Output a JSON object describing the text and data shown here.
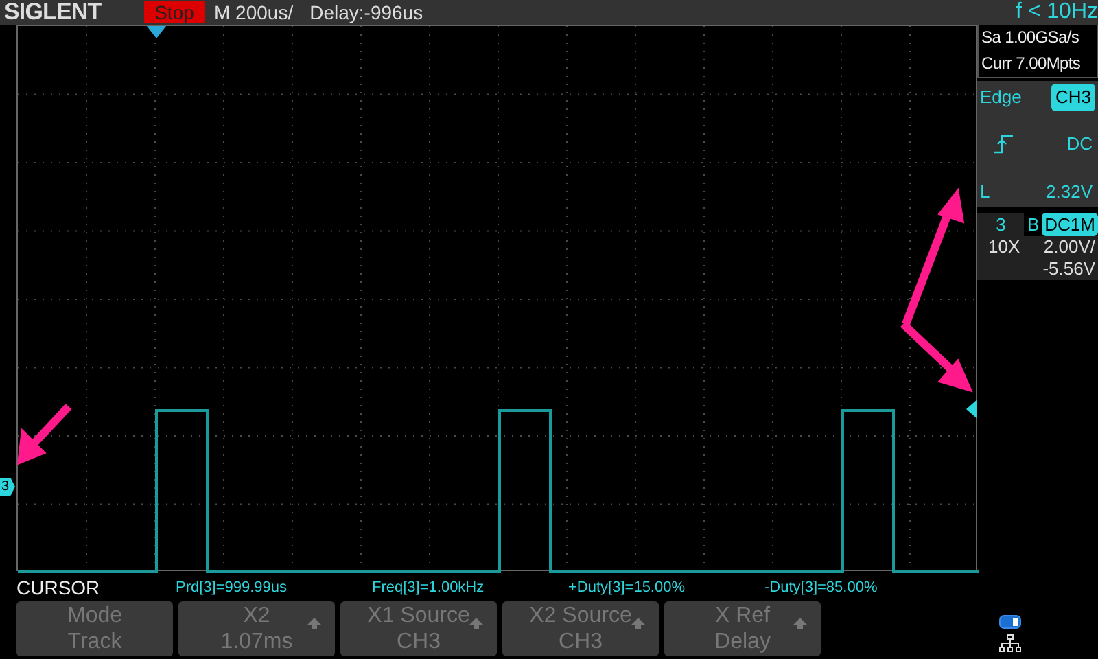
{
  "header": {
    "logo": "SIGLENT",
    "run_state": "Stop",
    "timebase": "M 200us/",
    "delay": "Delay:-996us",
    "frequency": "f < 10Hz"
  },
  "acquisition": {
    "sample_rate": "Sa 1.00GSa/s",
    "memory": "Curr 7.00Mpts"
  },
  "trigger": {
    "type": "Edge",
    "source": "CH3",
    "coupling": "DC",
    "level_label": "L",
    "level_value": "2.32V"
  },
  "channel": {
    "number": "3",
    "bandwidth_flag": "B",
    "coupling": "DC1M",
    "probe": "10X",
    "scale": "2.00V/",
    "offset": "-5.56V"
  },
  "channel_marker": "3",
  "measurements": {
    "title": "CURSOR",
    "items": [
      "Prd[3]=999.99us",
      "Freq[3]=1.00kHz",
      "+Duty[3]=15.00%",
      "-Duty[3]=85.00%"
    ]
  },
  "softkeys": [
    {
      "kind": "plain",
      "label": "Mode",
      "value": "Track"
    },
    {
      "kind": "adjust",
      "label": "X2",
      "value": "1.07ms"
    },
    {
      "kind": "adjust",
      "label": "X1 Source",
      "value": "CH3"
    },
    {
      "kind": "adjust",
      "label": "X2 Source",
      "value": "CH3"
    },
    {
      "kind": "adjust",
      "label": "X Ref",
      "value": "Delay"
    }
  ]
}
